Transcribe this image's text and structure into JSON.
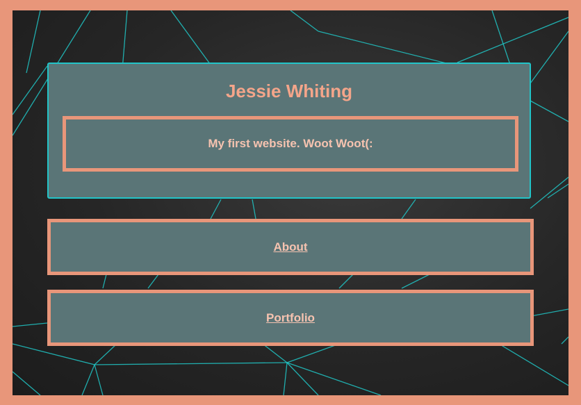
{
  "header": {
    "title": "Jessie Whiting",
    "tagline": "My first website. Woot Woot(:"
  },
  "nav": {
    "items": [
      {
        "label": " About"
      },
      {
        "label": "Portfolio"
      }
    ]
  },
  "colors": {
    "accent": "#e8967a",
    "panel": "#5a7577",
    "teal_border": "#22c4c8",
    "text": "#f6c3b0",
    "background": "#262626"
  }
}
